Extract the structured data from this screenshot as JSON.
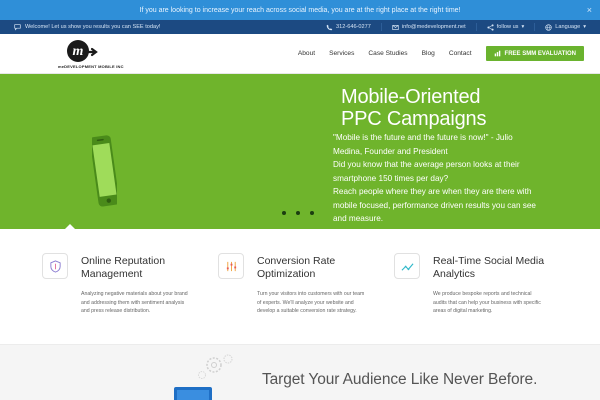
{
  "announcement": {
    "text": "If you are looking to increase your reach across social media, you are at the right place at the right time!",
    "close": "×"
  },
  "topbar": {
    "welcome": "Welcome! Let us show you results you can SEE today!",
    "phone": "312-646-0277",
    "email": "info@medevelopment.net",
    "follow": "follow us",
    "language": "Language"
  },
  "logo": {
    "text": "meDEVELOPMENT MOBILE INC"
  },
  "nav": {
    "items": [
      "About",
      "Services",
      "Case Studies",
      "Blog",
      "Contact"
    ],
    "cta": "FREE SMM EVALUATION"
  },
  "hero": {
    "title_line1": "Mobile-Oriented",
    "title_line2": "PPC Campaigns",
    "quote_line1": "\"Mobile is the future and the future is now!\" - Julio",
    "quote_line2": "Medina, Founder and President",
    "q_line1": "Did you know that the average person looks at their",
    "q_line2": "smartphone 150 times per day?",
    "reach_line1": "Reach people where they are when they are there with",
    "reach_line2": "mobile focused, performance driven results you can see",
    "reach_line3": "and measure.",
    "slide_count": 3,
    "accent": "#6fb42c"
  },
  "features": [
    {
      "icon": "shield-icon",
      "title_line1": "Online Reputation",
      "title_line2": "Management",
      "desc_line1": "Analyzing negative materials about your brand",
      "desc_line2": "and addressing them with sentiment analysis",
      "desc_line3": "and press release distribution."
    },
    {
      "icon": "sliders-icon",
      "title_line1": "Conversion Rate",
      "title_line2": "Optimization",
      "desc_line1": "Turn your visitors into customers with our team",
      "desc_line2": "of experts. We'll analyze your website and",
      "desc_line3": "develop a suitable conversion rate strategy."
    },
    {
      "icon": "trend-chart-icon",
      "title_line1": "Real-Time Social Media",
      "title_line2": "Analytics",
      "desc_line1": "We produce bespoke reports and technical",
      "desc_line2": "audits that can help your business with specific",
      "desc_line3": "areas of digital marketing."
    }
  ],
  "bottom": {
    "headline": "Target Your Audience Like Never Before."
  },
  "colors": {
    "announce_bg": "#2f8fd8",
    "topbar_bg": "#1c4a82",
    "cta_bg": "#6ab32e"
  }
}
